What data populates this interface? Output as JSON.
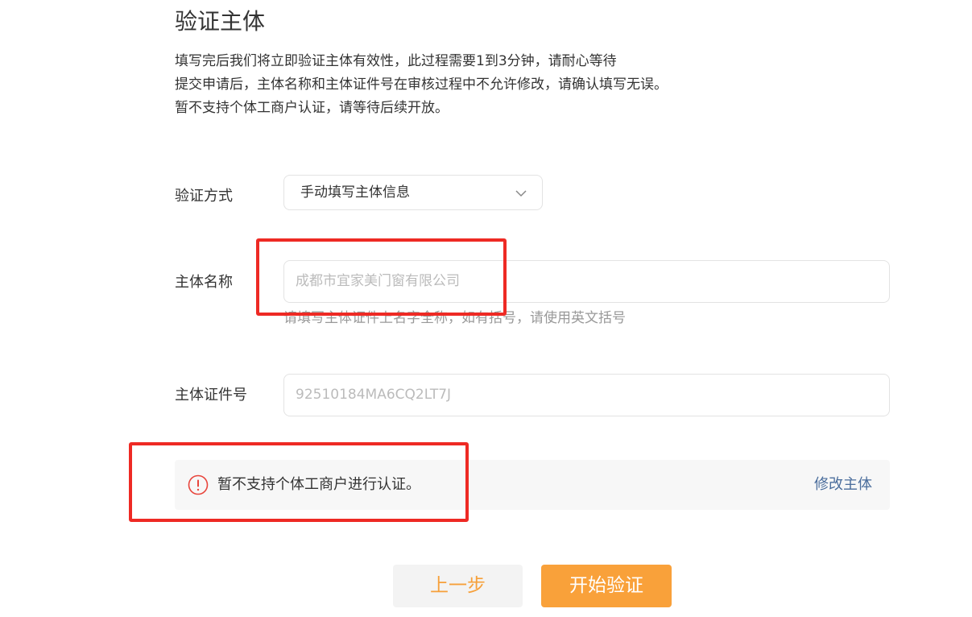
{
  "header": {
    "title": "验证主体",
    "desc_lines": [
      "填写完后我们将立即验证主体有效性，此过程需要1到3分钟，请耐心等待",
      "提交申请后，主体名称和主体证件号在审核过程中不允许修改，请确认填写无误。",
      "暂不支持个体工商户认证，请等待后续开放。"
    ]
  },
  "form": {
    "method": {
      "label": "验证方式",
      "value": "手动填写主体信息"
    },
    "name": {
      "label": "主体名称",
      "placeholder": "成都市宜家美门窗有限公司",
      "hint": "请填写主体证件上名字全称，如有括号，请使用英文括号"
    },
    "cert": {
      "label": "主体证件号",
      "placeholder": "92510184MA6CQ2LT7J"
    }
  },
  "alert": {
    "text": "暂不支持个体工商户进行认证。",
    "link": "修改主体"
  },
  "buttons": {
    "prev": "上一步",
    "start": "开始验证"
  },
  "colors": {
    "accent": "#f9a13a",
    "annotation": "#ee2a24",
    "link": "#4a6d9c",
    "warning_icon": "#e8453c"
  }
}
